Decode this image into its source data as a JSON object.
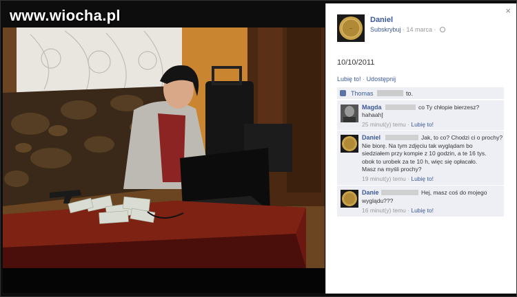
{
  "watermark": "www.wiocha.pl",
  "close_icon": "×",
  "post": {
    "author": "Daniel",
    "subscribe": "Subskrybuj",
    "date": "· 14 marca ·",
    "text": "10/10/2011",
    "like_label": "Lubię to!",
    "separator": "·",
    "share_label": "Udostępnij"
  },
  "likes": {
    "name": "Thomas",
    "rest": "to."
  },
  "comments": [
    {
      "name": "Magda",
      "text_first": "co Ty chłopie bierzesz?",
      "text_rest": "hahaah]",
      "time": "25 minut(y) temu ·",
      "like": "Lubię to!"
    },
    {
      "name": "Daniel",
      "text_first": "Jak, to co? Chodzi ci o prochy?",
      "text_lines": [
        "Nie biorę. Na tym zdjęciu tak wyglądam bo",
        "siedziałem przy kompie z 10 godzin, a te 16 tys.",
        "obok to urobek za te 10 h, więc się opłacało.",
        "Masz na myśli prochy?"
      ],
      "time": "19 minut(y) temu ·",
      "like": "Lubię to!"
    },
    {
      "name": "Danie",
      "text_first": "Hej, masz coś do mojego",
      "text_rest": "wyglądu???",
      "time": "16 minut(y) temu ·",
      "like": "Lubię to!"
    }
  ],
  "icons": {
    "close": "close-icon",
    "globe": "globe-icon",
    "thumb": "thumbs-up-icon"
  },
  "colors": {
    "link": "#3b5998",
    "comment_bg": "#edeff4",
    "stage": "#0d0d0d"
  }
}
